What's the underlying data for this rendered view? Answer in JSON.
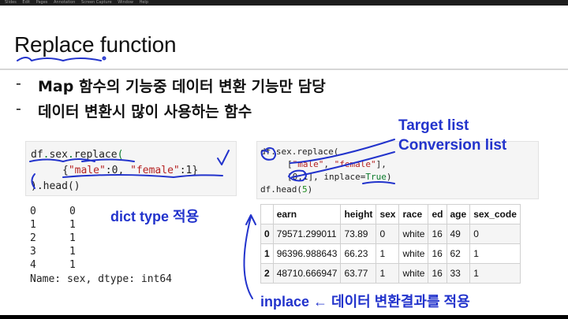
{
  "menubar": [
    "Slides",
    "Edit",
    "Pages",
    "Annotation",
    "Screen Capture",
    "Window",
    "Help"
  ],
  "slide": {
    "title": "Replace function",
    "bullets": [
      "Map 함수의 기능중 데이터 변환 기능만 담당",
      "데이터 변환시 많이 사용하는 함수"
    ],
    "bullet_marker": "-"
  },
  "code_left": {
    "line1": {
      "obj": "df",
      "dot1": ".",
      "attr": "sex",
      "dot2": ".",
      "method": "replace",
      "paren": "("
    },
    "line2": {
      "open": "{",
      "k1": "\"male\"",
      "sep1": ":0, ",
      "k2": "\"female\"",
      "sep2": ":1}"
    },
    "line3": ").head()"
  },
  "code_right": {
    "line1": "df.sex.replace(",
    "line2": {
      "open": "[",
      "k1": "\"male\"",
      "sep": ", ",
      "k2": "\"female\"",
      "close": "],"
    },
    "line3": {
      "text": "[0,1], inplace=",
      "kw": "True",
      "close": ")"
    },
    "line4": {
      "text": "df.head(",
      "num": "5",
      "close": ")"
    }
  },
  "series_output": {
    "rows": [
      {
        "index": "0",
        "value": "0"
      },
      {
        "index": "1",
        "value": "1"
      },
      {
        "index": "2",
        "value": "1"
      },
      {
        "index": "3",
        "value": "1"
      },
      {
        "index": "4",
        "value": "1"
      }
    ],
    "footer": "Name: sex, dtype: int64"
  },
  "dataframe": {
    "columns": [
      "",
      "earn",
      "height",
      "sex",
      "race",
      "ed",
      "age",
      "sex_code"
    ],
    "rows": [
      [
        "0",
        "79571.299011",
        "73.89",
        "0",
        "white",
        "16",
        "49",
        "0"
      ],
      [
        "1",
        "96396.988643",
        "66.23",
        "1",
        "white",
        "16",
        "62",
        "1"
      ],
      [
        "2",
        "48710.666947",
        "63.77",
        "1",
        "white",
        "16",
        "33",
        "1"
      ]
    ]
  },
  "annotations": {
    "target": "Target list",
    "conversion": "Conversion list",
    "dict": "dict type 적용",
    "inplace": "inplace ← 데이터 변환결과를 적용"
  },
  "colors": {
    "ink_blue": "#2233cc",
    "string_red": "#b52222",
    "keyword_green": "#0a7a2a"
  }
}
